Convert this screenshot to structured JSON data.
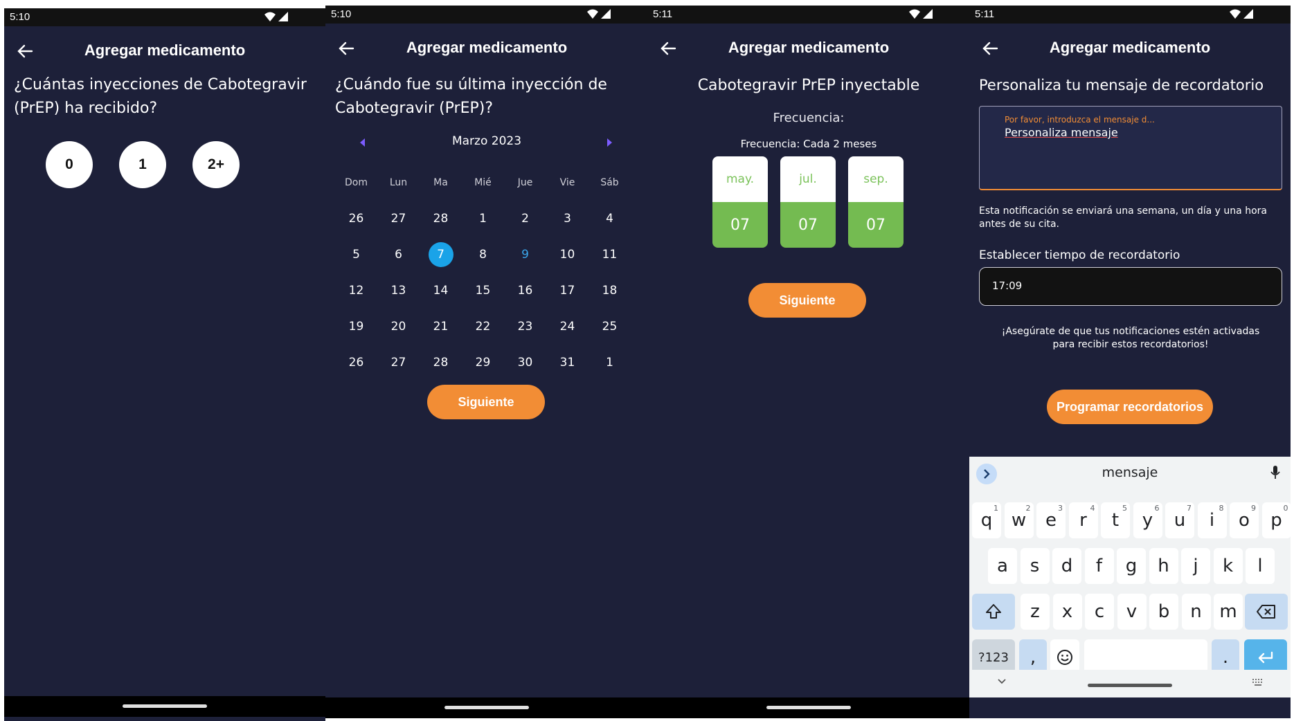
{
  "common": {
    "app_title": "Agregar medicamento",
    "next_label": "Siguiente"
  },
  "s1": {
    "time": "5:10",
    "question": "¿Cuántas inyecciones de Cabotegravir (PrEP) ha recibido?",
    "options": [
      "0",
      "1",
      "2+"
    ]
  },
  "s2": {
    "time": "5:10",
    "question": "¿Cuándo fue su última inyección de Cabotegravir (PrEP)?",
    "month_label": "Marzo 2023",
    "weekdays": [
      "Dom",
      "Lun",
      "Ma",
      "Mié",
      "Jue",
      "Vie",
      "Sáb"
    ],
    "weeks": [
      [
        "26",
        "27",
        "28",
        "1",
        "2",
        "3",
        "4"
      ],
      [
        "5",
        "6",
        "7",
        "8",
        "9",
        "10",
        "11"
      ],
      [
        "12",
        "13",
        "14",
        "15",
        "16",
        "17",
        "18"
      ],
      [
        "19",
        "20",
        "21",
        "22",
        "23",
        "24",
        "25"
      ],
      [
        "26",
        "27",
        "28",
        "29",
        "30",
        "31",
        "1"
      ]
    ],
    "selected_day": "7",
    "today_day": "9"
  },
  "s3": {
    "time": "5:11",
    "medication": "Cabotegravir PrEP inyectable",
    "frequency_heading": "Frecuencia:",
    "frequency_value": "Frecuencia: Cada 2 meses",
    "schedule": [
      {
        "month": "may.",
        "day": "07"
      },
      {
        "month": "jul.",
        "day": "07"
      },
      {
        "month": "sep.",
        "day": "07"
      }
    ]
  },
  "s4": {
    "time": "5:11",
    "heading": "Personaliza tu mensaje de recordatorio",
    "message_placeholder": "Por favor, introduzca el mensaje d...",
    "message_value": "Personaliza mensaje",
    "notice": "Esta notificación se enviará una semana, un día y una hora antes de su cita.",
    "time_label": "Establecer tiempo de recordatorio",
    "time_value": "17:09",
    "reminder_note": "¡Asegúrate de que tus notificaciones estén activadas para recibir estos recordatorios!",
    "program_button": "Programar recordatorios",
    "keyboard": {
      "suggestion": "mensaje",
      "row1": [
        {
          "k": "q",
          "n": "1"
        },
        {
          "k": "w",
          "n": "2"
        },
        {
          "k": "e",
          "n": "3"
        },
        {
          "k": "r",
          "n": "4"
        },
        {
          "k": "t",
          "n": "5"
        },
        {
          "k": "y",
          "n": "6"
        },
        {
          "k": "u",
          "n": "7"
        },
        {
          "k": "i",
          "n": "8"
        },
        {
          "k": "o",
          "n": "9"
        },
        {
          "k": "p",
          "n": "0"
        }
      ],
      "row2": [
        "a",
        "s",
        "d",
        "f",
        "g",
        "h",
        "j",
        "k",
        "l"
      ],
      "row3": [
        "z",
        "x",
        "c",
        "v",
        "b",
        "n",
        "m"
      ],
      "symbols_key": "?123",
      "comma_key": ",",
      "period_key": "."
    }
  },
  "colors": {
    "background": "#1d2039",
    "accent_orange": "#f28d35",
    "calendar_selected": "#1aa3e8",
    "month_green": "#74bb51"
  }
}
